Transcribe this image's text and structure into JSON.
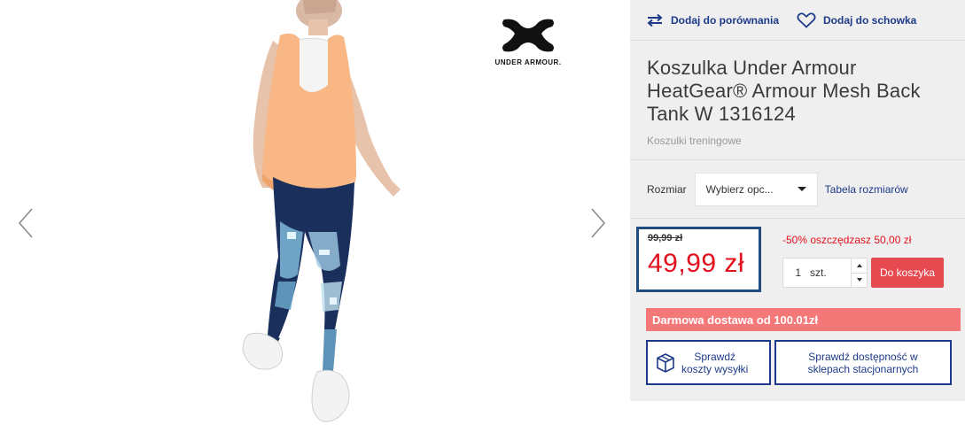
{
  "brand": {
    "logo_text": "UNDER ARMOUR."
  },
  "actions": {
    "compare_label": "Dodaj do porównania",
    "wishlist_label": "Dodaj do schowka"
  },
  "product": {
    "title": "Koszulka Under Armour HeatGear® Armour Mesh Back Tank W 1316124",
    "category": "Koszulki treningowe"
  },
  "size": {
    "label": "Rozmiar",
    "selected": "Wybierz opc...",
    "table_link": "Tabela rozmiarów"
  },
  "price": {
    "old": "99,99 zł",
    "new": "49,99 zł",
    "discount": "-50% oszczędzasz 50,00 zł"
  },
  "quantity": {
    "value": "1",
    "unit": "szt."
  },
  "cart": {
    "add_label": "Do koszyka"
  },
  "delivery_banner": "Darmowa dostawa od 100.01zł",
  "checks": {
    "shipping_line1": "Sprawdź",
    "shipping_line2": "koszty wysyłki",
    "stores_line1": "Sprawdź dostępność w",
    "stores_line2": "sklepach stacjonarnych"
  },
  "colors": {
    "accent_blue": "#1d3a8a",
    "price_red": "#e3101d",
    "cart_button": "#e64a50",
    "banner": "#f57878",
    "price_frame": "#1f4d7f"
  }
}
